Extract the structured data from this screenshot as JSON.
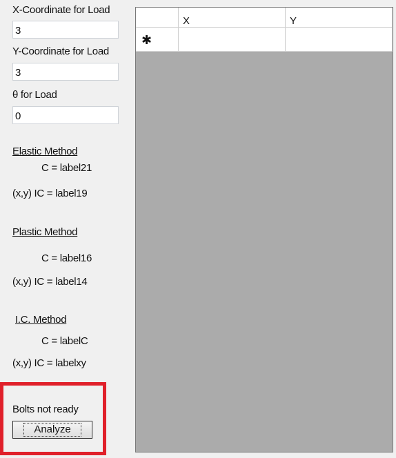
{
  "form": {
    "x_label": "X-Coordinate for Load",
    "x_value": "3",
    "y_label": "Y-Coordinate for Load",
    "y_value": "3",
    "theta_label": "θ for Load",
    "theta_value": "0"
  },
  "elastic": {
    "heading": "Elastic Method",
    "c": "C = label21",
    "ic": "(x,y) IC = label19"
  },
  "plastic": {
    "heading": "Plastic Method",
    "c": "C = label16",
    "ic": "(x,y) IC = label14"
  },
  "ic_method": {
    "heading": "I.C. Method",
    "c": "C = labelC",
    "ic": "(x,y) IC = labelxy"
  },
  "status": {
    "text": "Bolts not ready",
    "button": "Analyze",
    "highlight_color": "#e0202a"
  },
  "grid": {
    "columns": [
      "X",
      "Y"
    ],
    "new_row_marker": "✱"
  }
}
